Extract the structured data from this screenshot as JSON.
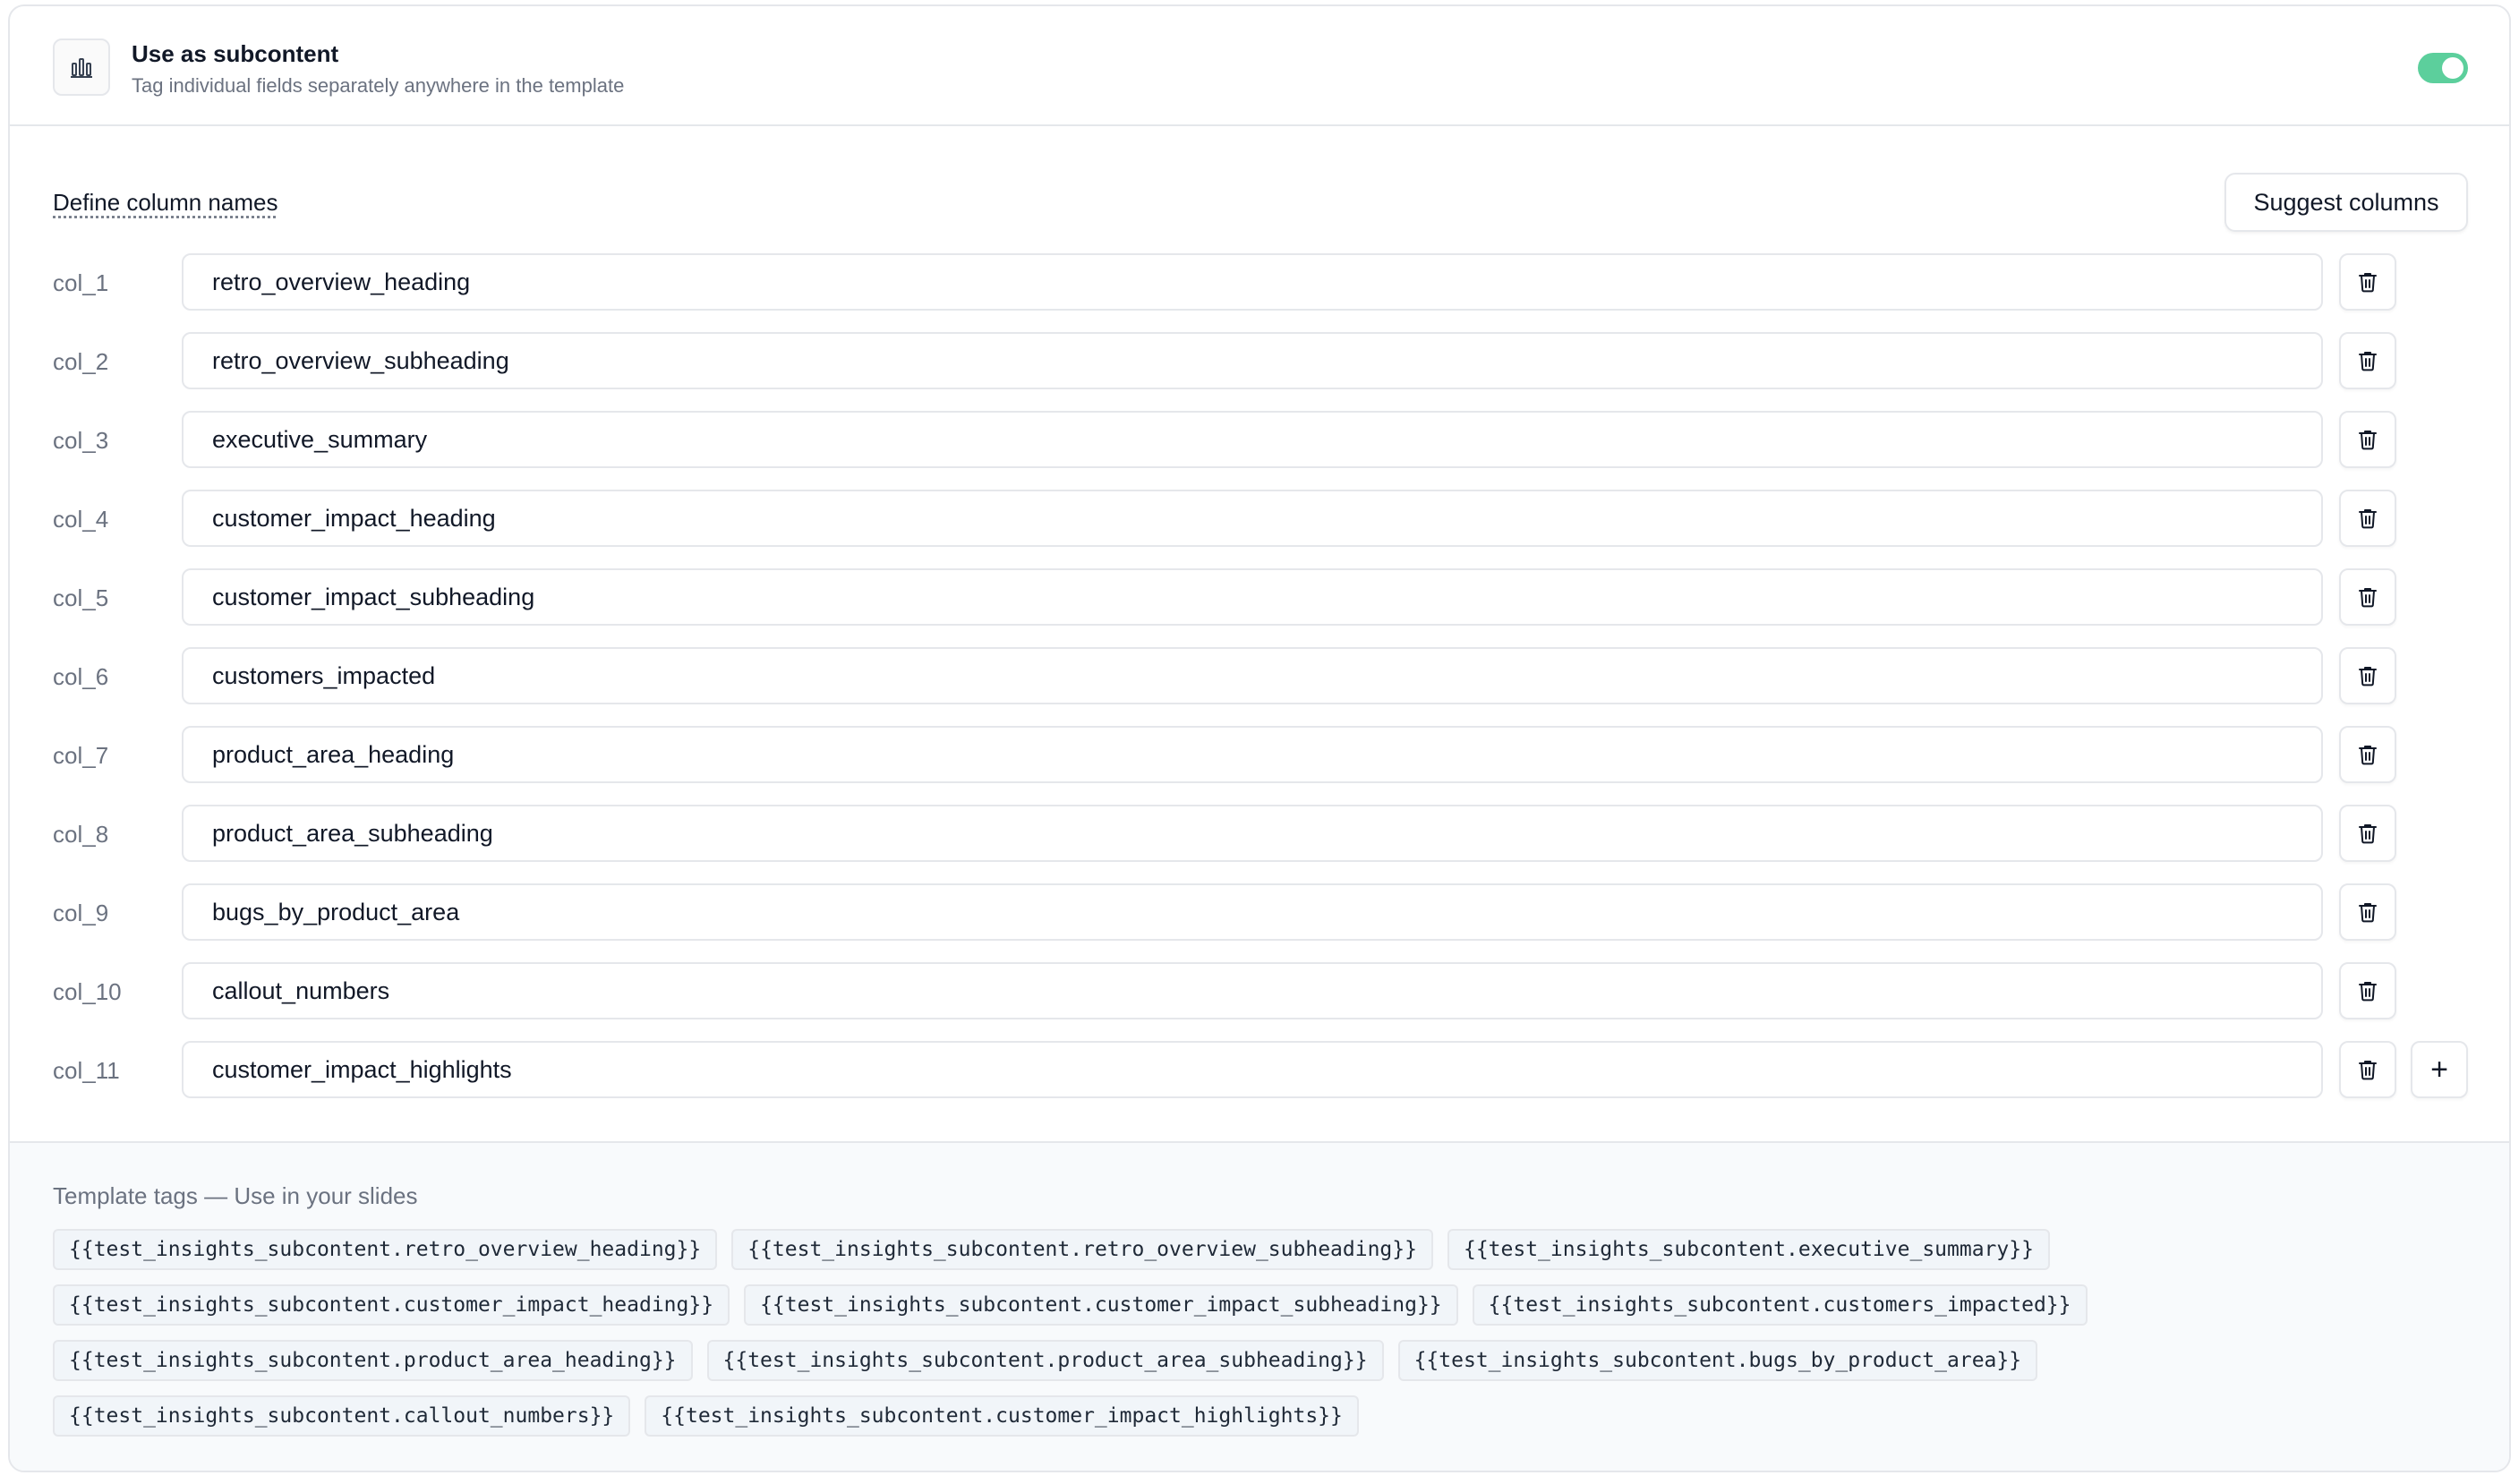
{
  "header": {
    "icon": "bar-chart-icon",
    "title": "Use as subcontent",
    "subtitle": "Tag individual fields separately anywhere in the template",
    "toggle_on": true,
    "accent": "#5ccf9c"
  },
  "columns": {
    "section_label": "Define column names",
    "suggest_label": "Suggest columns",
    "rows": [
      {
        "label": "col_1",
        "value": "retro_overview_heading"
      },
      {
        "label": "col_2",
        "value": "retro_overview_subheading"
      },
      {
        "label": "col_3",
        "value": "executive_summary"
      },
      {
        "label": "col_4",
        "value": "customer_impact_heading"
      },
      {
        "label": "col_5",
        "value": "customer_impact_subheading"
      },
      {
        "label": "col_6",
        "value": "customers_impacted"
      },
      {
        "label": "col_7",
        "value": "product_area_heading"
      },
      {
        "label": "col_8",
        "value": "product_area_subheading"
      },
      {
        "label": "col_9",
        "value": "bugs_by_product_area"
      },
      {
        "label": "col_10",
        "value": "callout_numbers"
      },
      {
        "label": "col_11",
        "value": "customer_impact_highlights"
      }
    ],
    "delete_icon": "trash-icon",
    "add_icon": "plus-icon",
    "add_label": "+"
  },
  "tags": {
    "title": "Template tags — Use in your slides",
    "items": [
      "{{test_insights_subcontent.retro_overview_heading}}",
      "{{test_insights_subcontent.retro_overview_subheading}}",
      "{{test_insights_subcontent.executive_summary}}",
      "{{test_insights_subcontent.customer_impact_heading}}",
      "{{test_insights_subcontent.customer_impact_subheading}}",
      "{{test_insights_subcontent.customers_impacted}}",
      "{{test_insights_subcontent.product_area_heading}}",
      "{{test_insights_subcontent.product_area_subheading}}",
      "{{test_insights_subcontent.bugs_by_product_area}}",
      "{{test_insights_subcontent.callout_numbers}}",
      "{{test_insights_subcontent.customer_impact_highlights}}"
    ]
  }
}
